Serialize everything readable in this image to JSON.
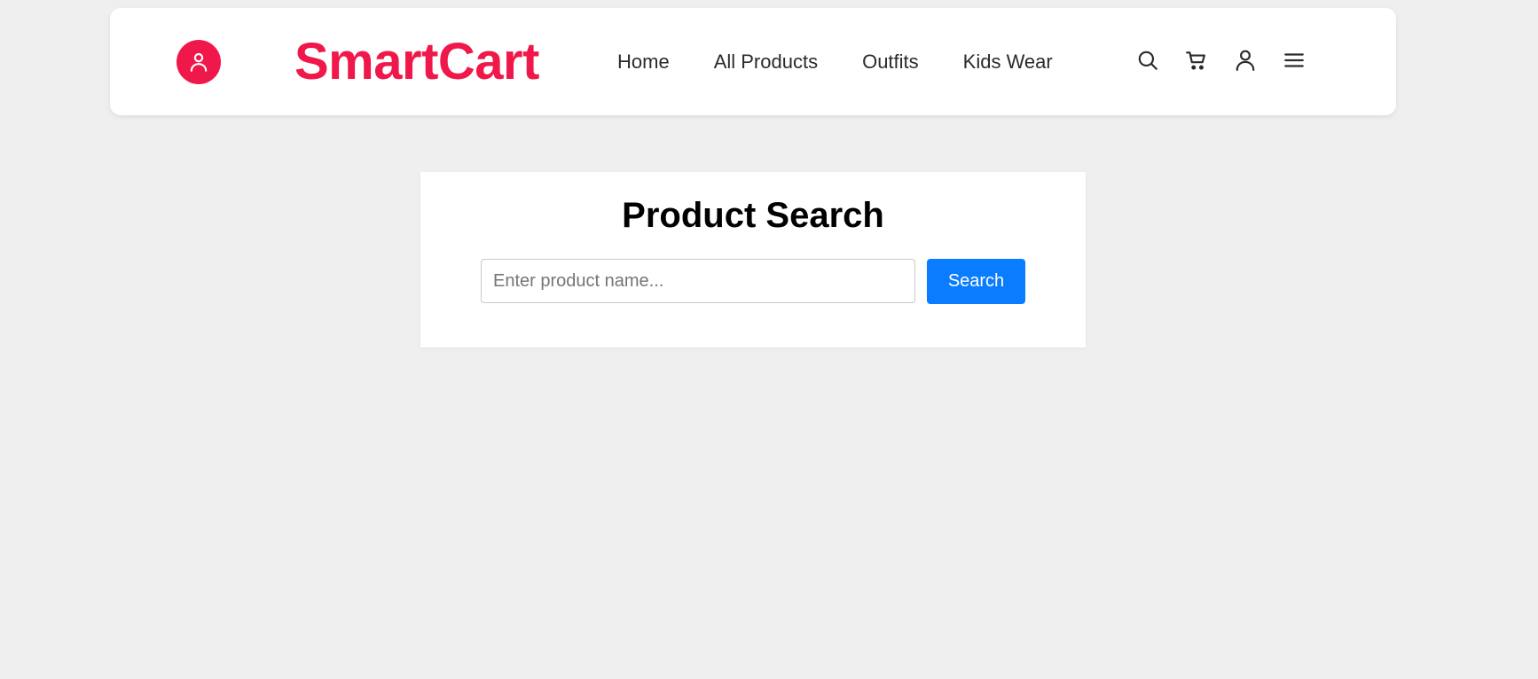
{
  "header": {
    "brand": "SmartCart",
    "brand_color": "#f0184a",
    "logo_icon": "user-circle-icon",
    "nav": [
      {
        "label": "Home"
      },
      {
        "label": "All Products"
      },
      {
        "label": "Outfits"
      },
      {
        "label": "Kids Wear"
      }
    ],
    "icons": [
      "search-icon",
      "cart-icon",
      "user-icon",
      "menu-icon"
    ]
  },
  "search": {
    "title": "Product Search",
    "placeholder": "Enter product name...",
    "value": "",
    "button_label": "Search",
    "button_color": "#0a7cff"
  }
}
